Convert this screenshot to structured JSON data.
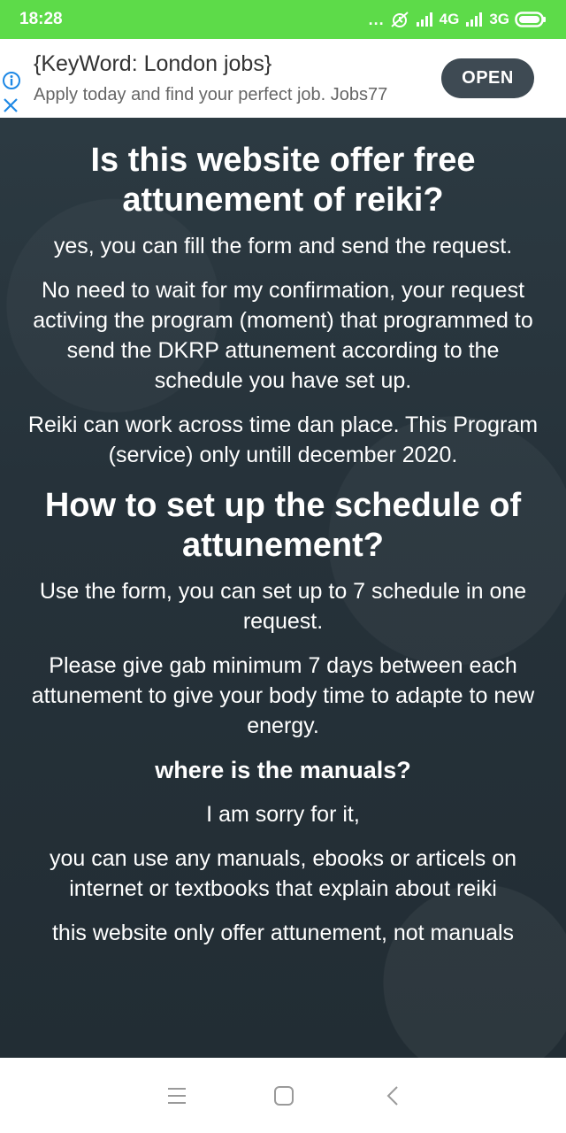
{
  "status_bar": {
    "time": "18:28",
    "dots": "...",
    "network_4g": "4G",
    "network_3g": "3G",
    "icons": [
      "alarm-icon",
      "signal-icon",
      "battery-icon"
    ],
    "background_color": "#5ddb49"
  },
  "ad": {
    "title": "{KeyWord: London jobs}",
    "subtitle": "Apply today and find your perfect job. Jobs77",
    "open_label": "OPEN",
    "icons": [
      "info-icon",
      "close-icon"
    ],
    "accent_color": "#3e4a53"
  },
  "content": {
    "heading1": "Is this website offer free attunement of reiki?",
    "p1": "yes, you can fill the form and send the request.",
    "p2": "No need to wait for my confirmation, your request activing the program (moment) that programmed to send the DKRP attunement according to the schedule you have set up.",
    "p3": "Reiki can work across time dan place. This Program (service) only untill december 2020.",
    "heading2": "How to set up the schedule of attunement?",
    "p4": "Use the form, you can set up to 7 schedule in one request.",
    "p5": "Please give gab minimum 7 days between each attunement to give your body time to adapte to new energy.",
    "heading3": "where is the manuals?",
    "p6": "I am sorry for it,",
    "p7": "you can use any manuals, ebooks or articels on internet or textbooks that explain about reiki",
    "p8": "this website only offer attunement, not manuals"
  },
  "nav_bar": {
    "icons": [
      "menu-icon",
      "home-icon",
      "back-icon"
    ]
  }
}
